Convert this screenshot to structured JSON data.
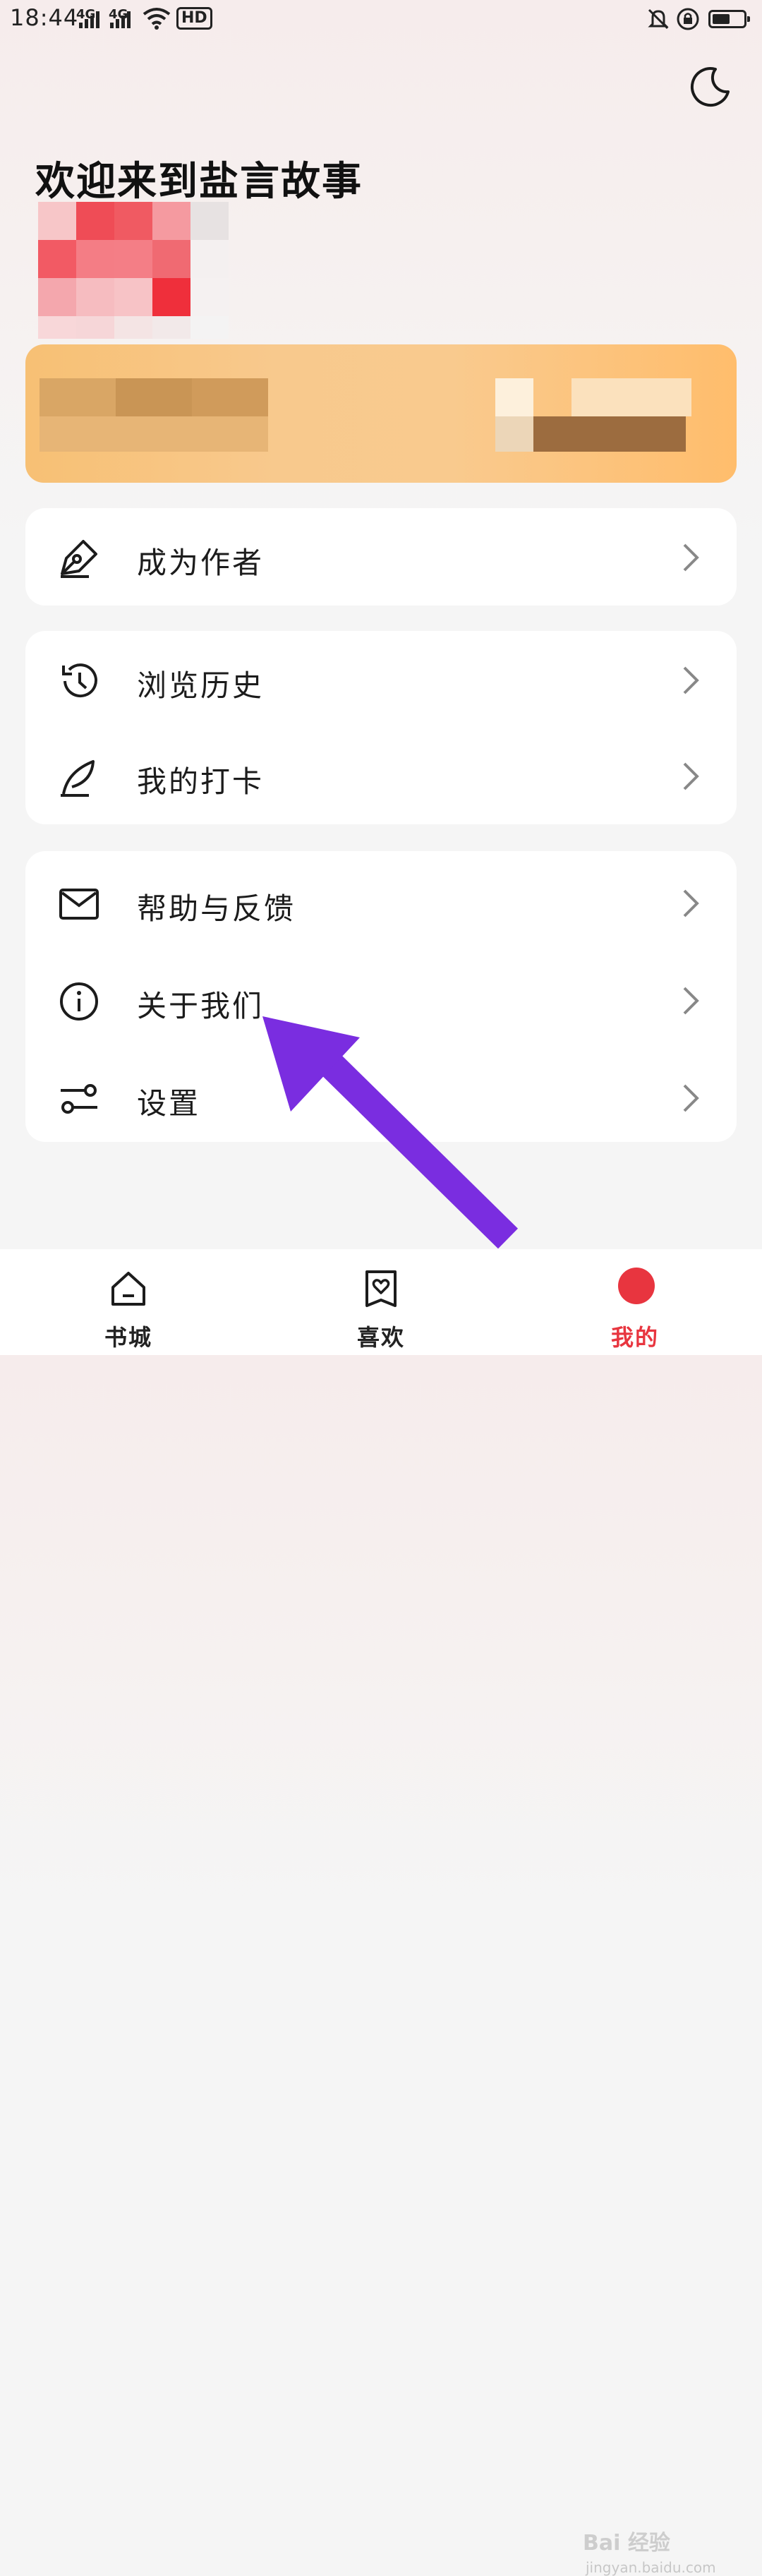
{
  "status_bar": {
    "time": "18:44",
    "network1": "4G",
    "network2": "4G",
    "hd_label": "HD"
  },
  "header": {
    "welcome": "欢迎来到盐言故事",
    "theme_icon": "moon-icon"
  },
  "menu": {
    "group1": [
      {
        "label": "成为作者",
        "icon": "pen-nib-icon"
      }
    ],
    "group2": [
      {
        "label": "浏览历史",
        "icon": "history-icon"
      },
      {
        "label": "我的打卡",
        "icon": "feather-icon"
      }
    ],
    "group3": [
      {
        "label": "帮助与反馈",
        "icon": "mail-icon"
      },
      {
        "label": "关于我们",
        "icon": "info-icon"
      },
      {
        "label": "设置",
        "icon": "sliders-icon"
      }
    ]
  },
  "bottom_nav": {
    "items": [
      {
        "label": "书城",
        "icon": "home-icon"
      },
      {
        "label": "喜欢",
        "icon": "heart-bookmark-icon"
      },
      {
        "label": "我的",
        "icon": "avatar-icon"
      }
    ],
    "active_index": 2
  },
  "watermark": {
    "brand": "Bai 经验",
    "url": "jingyan.baidu.com"
  },
  "colors": {
    "accent": "#e8353f",
    "annotation_arrow": "#7a2de0",
    "vip_card": "#f9c480"
  }
}
